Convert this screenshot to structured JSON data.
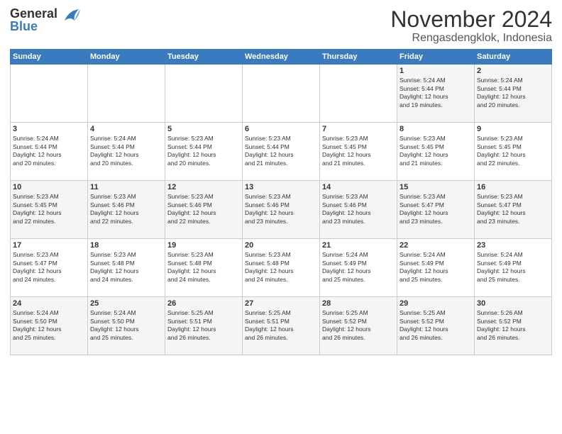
{
  "logo": {
    "line1": "General",
    "line2": "Blue"
  },
  "title": "November 2024",
  "location": "Rengasdengklok, Indonesia",
  "weekdays": [
    "Sunday",
    "Monday",
    "Tuesday",
    "Wednesday",
    "Thursday",
    "Friday",
    "Saturday"
  ],
  "weeks": [
    [
      {
        "day": "",
        "info": ""
      },
      {
        "day": "",
        "info": ""
      },
      {
        "day": "",
        "info": ""
      },
      {
        "day": "",
        "info": ""
      },
      {
        "day": "",
        "info": ""
      },
      {
        "day": "1",
        "info": "Sunrise: 5:24 AM\nSunset: 5:44 PM\nDaylight: 12 hours\nand 19 minutes."
      },
      {
        "day": "2",
        "info": "Sunrise: 5:24 AM\nSunset: 5:44 PM\nDaylight: 12 hours\nand 20 minutes."
      }
    ],
    [
      {
        "day": "3",
        "info": "Sunrise: 5:24 AM\nSunset: 5:44 PM\nDaylight: 12 hours\nand 20 minutes."
      },
      {
        "day": "4",
        "info": "Sunrise: 5:24 AM\nSunset: 5:44 PM\nDaylight: 12 hours\nand 20 minutes."
      },
      {
        "day": "5",
        "info": "Sunrise: 5:23 AM\nSunset: 5:44 PM\nDaylight: 12 hours\nand 20 minutes."
      },
      {
        "day": "6",
        "info": "Sunrise: 5:23 AM\nSunset: 5:44 PM\nDaylight: 12 hours\nand 21 minutes."
      },
      {
        "day": "7",
        "info": "Sunrise: 5:23 AM\nSunset: 5:45 PM\nDaylight: 12 hours\nand 21 minutes."
      },
      {
        "day": "8",
        "info": "Sunrise: 5:23 AM\nSunset: 5:45 PM\nDaylight: 12 hours\nand 21 minutes."
      },
      {
        "day": "9",
        "info": "Sunrise: 5:23 AM\nSunset: 5:45 PM\nDaylight: 12 hours\nand 22 minutes."
      }
    ],
    [
      {
        "day": "10",
        "info": "Sunrise: 5:23 AM\nSunset: 5:45 PM\nDaylight: 12 hours\nand 22 minutes."
      },
      {
        "day": "11",
        "info": "Sunrise: 5:23 AM\nSunset: 5:46 PM\nDaylight: 12 hours\nand 22 minutes."
      },
      {
        "day": "12",
        "info": "Sunrise: 5:23 AM\nSunset: 5:46 PM\nDaylight: 12 hours\nand 22 minutes."
      },
      {
        "day": "13",
        "info": "Sunrise: 5:23 AM\nSunset: 5:46 PM\nDaylight: 12 hours\nand 23 minutes."
      },
      {
        "day": "14",
        "info": "Sunrise: 5:23 AM\nSunset: 5:46 PM\nDaylight: 12 hours\nand 23 minutes."
      },
      {
        "day": "15",
        "info": "Sunrise: 5:23 AM\nSunset: 5:47 PM\nDaylight: 12 hours\nand 23 minutes."
      },
      {
        "day": "16",
        "info": "Sunrise: 5:23 AM\nSunset: 5:47 PM\nDaylight: 12 hours\nand 23 minutes."
      }
    ],
    [
      {
        "day": "17",
        "info": "Sunrise: 5:23 AM\nSunset: 5:47 PM\nDaylight: 12 hours\nand 24 minutes."
      },
      {
        "day": "18",
        "info": "Sunrise: 5:23 AM\nSunset: 5:48 PM\nDaylight: 12 hours\nand 24 minutes."
      },
      {
        "day": "19",
        "info": "Sunrise: 5:23 AM\nSunset: 5:48 PM\nDaylight: 12 hours\nand 24 minutes."
      },
      {
        "day": "20",
        "info": "Sunrise: 5:23 AM\nSunset: 5:48 PM\nDaylight: 12 hours\nand 24 minutes."
      },
      {
        "day": "21",
        "info": "Sunrise: 5:24 AM\nSunset: 5:49 PM\nDaylight: 12 hours\nand 25 minutes."
      },
      {
        "day": "22",
        "info": "Sunrise: 5:24 AM\nSunset: 5:49 PM\nDaylight: 12 hours\nand 25 minutes."
      },
      {
        "day": "23",
        "info": "Sunrise: 5:24 AM\nSunset: 5:49 PM\nDaylight: 12 hours\nand 25 minutes."
      }
    ],
    [
      {
        "day": "24",
        "info": "Sunrise: 5:24 AM\nSunset: 5:50 PM\nDaylight: 12 hours\nand 25 minutes."
      },
      {
        "day": "25",
        "info": "Sunrise: 5:24 AM\nSunset: 5:50 PM\nDaylight: 12 hours\nand 25 minutes."
      },
      {
        "day": "26",
        "info": "Sunrise: 5:25 AM\nSunset: 5:51 PM\nDaylight: 12 hours\nand 26 minutes."
      },
      {
        "day": "27",
        "info": "Sunrise: 5:25 AM\nSunset: 5:51 PM\nDaylight: 12 hours\nand 26 minutes."
      },
      {
        "day": "28",
        "info": "Sunrise: 5:25 AM\nSunset: 5:52 PM\nDaylight: 12 hours\nand 26 minutes."
      },
      {
        "day": "29",
        "info": "Sunrise: 5:25 AM\nSunset: 5:52 PM\nDaylight: 12 hours\nand 26 minutes."
      },
      {
        "day": "30",
        "info": "Sunrise: 5:26 AM\nSunset: 5:52 PM\nDaylight: 12 hours\nand 26 minutes."
      }
    ]
  ]
}
